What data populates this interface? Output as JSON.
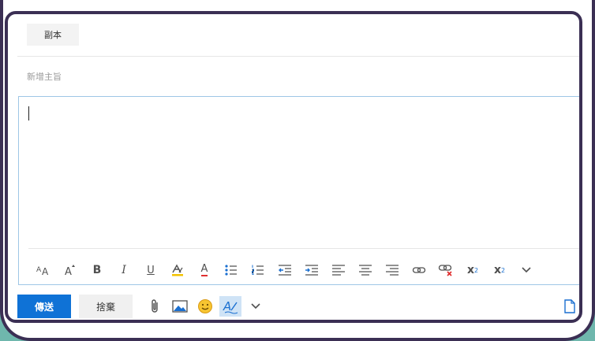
{
  "compose": {
    "cc_label": "副本",
    "subject_placeholder": "新增主旨",
    "subject_value": "",
    "body_text": ""
  },
  "format_toolbar": {
    "items": [
      {
        "name": "font-size-icon"
      },
      {
        "name": "increase-font-icon"
      },
      {
        "name": "bold-icon",
        "glyph": "B"
      },
      {
        "name": "italic-icon",
        "glyph": "I"
      },
      {
        "name": "underline-icon",
        "glyph": "U"
      },
      {
        "name": "highlight-icon"
      },
      {
        "name": "font-color-icon",
        "glyph": "A"
      },
      {
        "name": "bullets-icon"
      },
      {
        "name": "numbering-icon"
      },
      {
        "name": "decrease-indent-icon"
      },
      {
        "name": "increase-indent-icon"
      },
      {
        "name": "align-left-icon"
      },
      {
        "name": "align-center-icon"
      },
      {
        "name": "align-right-icon"
      },
      {
        "name": "insert-link-icon"
      },
      {
        "name": "remove-link-icon"
      },
      {
        "name": "superscript-icon",
        "glyph": "x",
        "sup": "2"
      },
      {
        "name": "subscript-icon",
        "glyph": "x",
        "sub": "2"
      },
      {
        "name": "more-options-icon"
      }
    ]
  },
  "actions": {
    "send_label": "傳送",
    "discard_label": "捨棄"
  },
  "colors": {
    "send_button": "#0f72d6",
    "frame": "#3b2f54",
    "highlight_yellow": "#f2c200",
    "font_color_red": "#e03030",
    "indent_blue": "#1a6fd0",
    "active_button_bg": "#cfe3f6",
    "outside_bg": "#6fb7ad"
  }
}
